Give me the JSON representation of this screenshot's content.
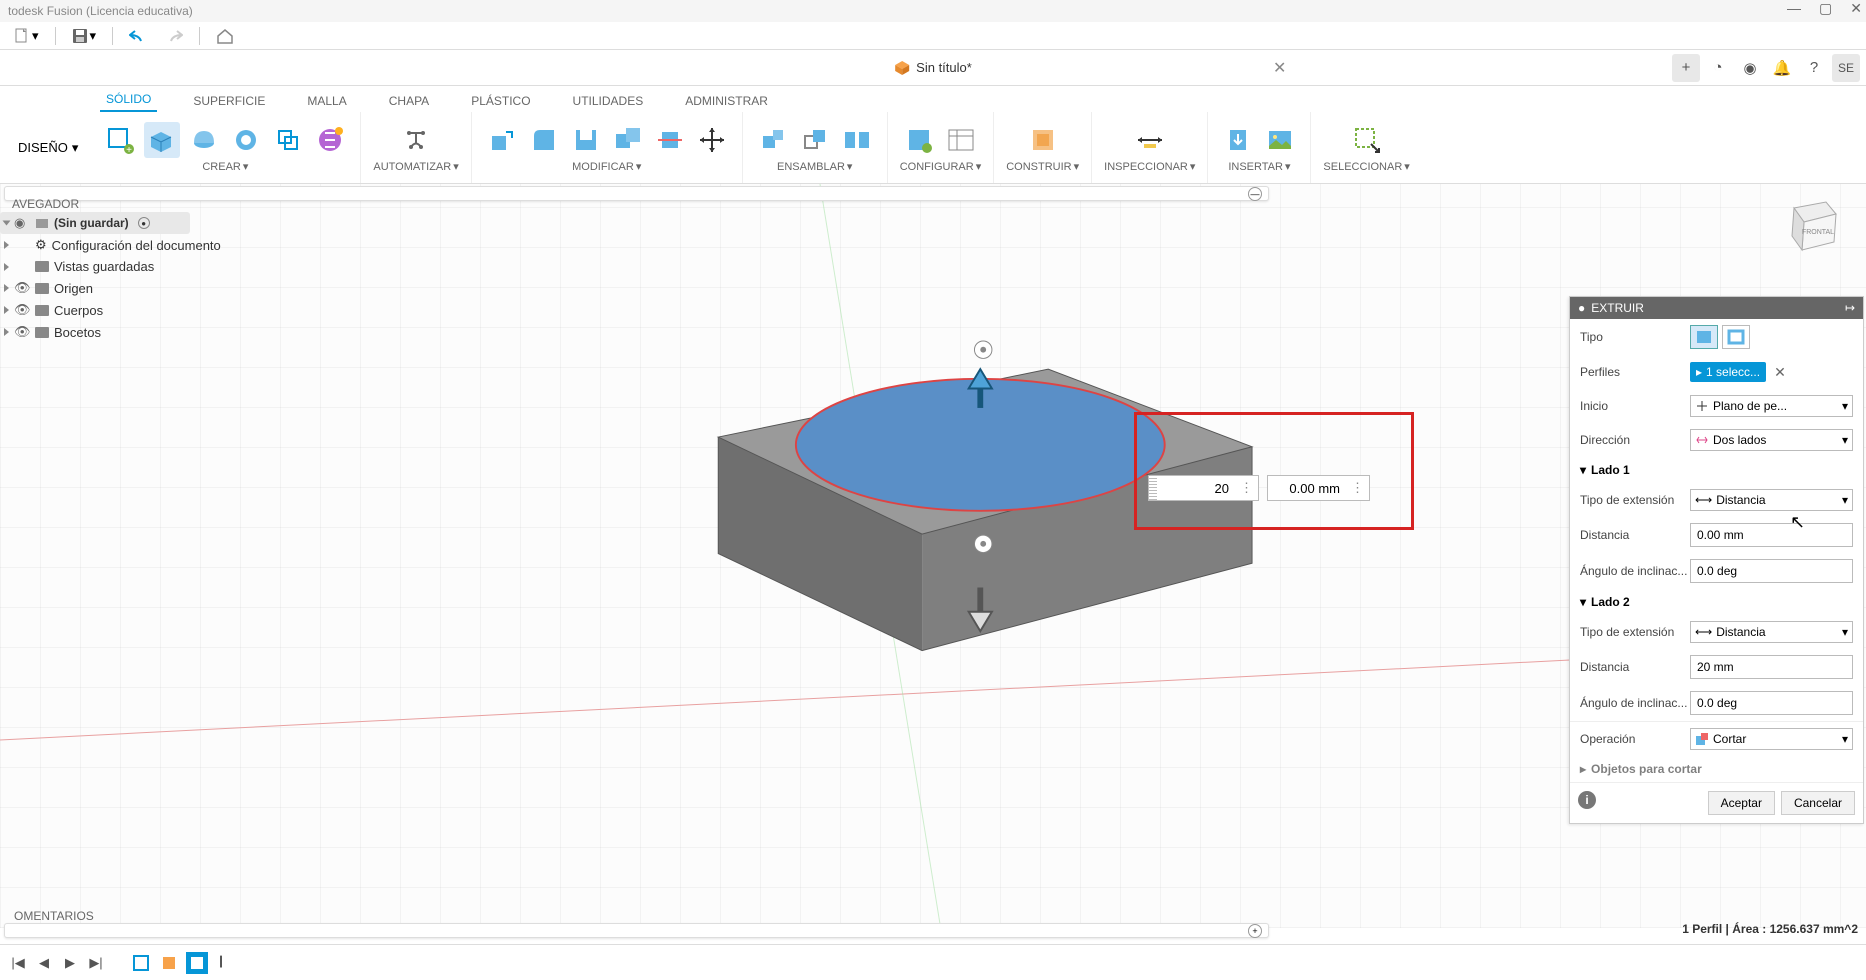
{
  "app_title": "todesk Fusion (Licencia educativa)",
  "tab": {
    "title": "Sin título*"
  },
  "topright_initials": "SE",
  "design_btn": "DISEÑO",
  "ribbon_tabs": [
    "SÓLIDO",
    "SUPERFICIE",
    "MALLA",
    "CHAPA",
    "PLÁSTICO",
    "UTILIDADES",
    "ADMINISTRAR"
  ],
  "ribbon_groups": {
    "crear": "CREAR",
    "automatizar": "AUTOMATIZAR",
    "modificar": "MODIFICAR",
    "ensamblar": "ENSAMBLAR",
    "configurar": "CONFIGURAR",
    "construir": "CONSTRUIR",
    "inspeccionar": "INSPECCIONAR",
    "insertar": "INSERTAR",
    "seleccionar": "SELECCIONAR"
  },
  "browser": {
    "header": "AVEGADOR",
    "root": "(Sin guardar)",
    "items": [
      {
        "label": "Configuración del documento",
        "icon": "gear"
      },
      {
        "label": "Vistas guardadas",
        "icon": "folder"
      },
      {
        "label": "Origen",
        "icon": "folder",
        "eye": true
      },
      {
        "label": "Cuerpos",
        "icon": "folder",
        "eye": true
      },
      {
        "label": "Bocetos",
        "icon": "folder",
        "eye": true
      }
    ]
  },
  "viewcube_face": "FRONTAL",
  "inline": {
    "val1": "20",
    "val2": "0.00 mm"
  },
  "panel": {
    "title": "EXTRUIR",
    "tipo": "Tipo",
    "perfiles": "Perfiles",
    "perfiles_chip": "1 selecc...",
    "inicio": "Inicio",
    "inicio_val": "Plano de pe...",
    "direccion": "Dirección",
    "direccion_val": "Dos lados",
    "lado1": "Lado 1",
    "lado2": "Lado 2",
    "tipo_ext": "Tipo de extensión",
    "tipo_ext_val": "Distancia",
    "distancia": "Distancia",
    "dist1": "0.00 mm",
    "dist2": "20 mm",
    "angulo": "Ángulo de inclinac...",
    "ang1": "0.0 deg",
    "ang2": "0.0 deg",
    "operacion": "Operación",
    "operacion_val": "Cortar",
    "objetos": "Objetos para cortar",
    "aceptar": "Aceptar",
    "cancelar": "Cancelar"
  },
  "comments_header": "OMENTARIOS",
  "status": "1 Perfil | Área : 1256.637 mm^2"
}
